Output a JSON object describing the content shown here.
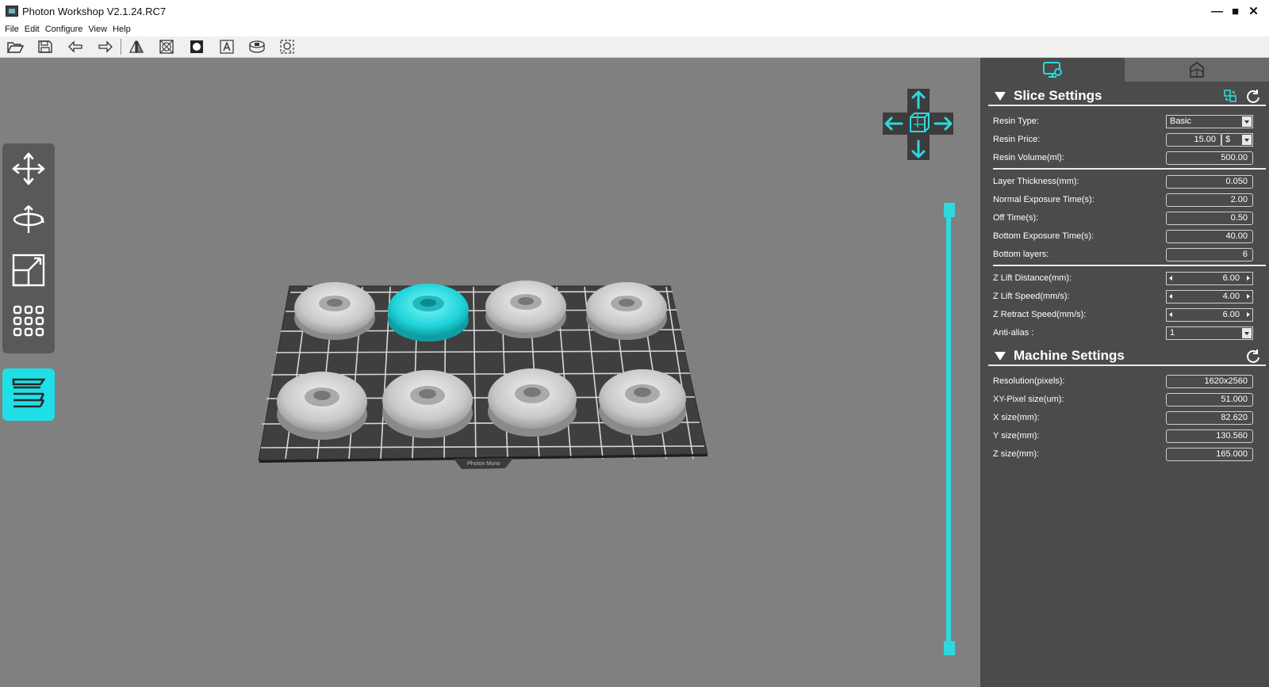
{
  "titlebar": {
    "title": "Photon Workshop V2.1.24.RC7"
  },
  "menu": [
    "File",
    "Edit",
    "Configure",
    "View",
    "Help"
  ],
  "toolbar": {
    "icons": [
      "open-icon",
      "save-icon",
      "undo-icon",
      "redo-icon",
      "mirror-icon",
      "hollow-icon",
      "mask-icon",
      "text-icon",
      "base-icon",
      "support-icon"
    ]
  },
  "left_tools": [
    "move-icon",
    "rotate-icon",
    "scale-icon",
    "arrange-icon"
  ],
  "slice_button": {
    "icon": "slice-layers-icon"
  },
  "build_plate": {
    "label": "Photon Mono"
  },
  "accent_color": "#1ee0e6",
  "slice_settings": {
    "title": "Slice Settings",
    "resin_type": {
      "label": "Resin Type:",
      "value": "Basic"
    },
    "resin_price": {
      "label": "Resin Price:",
      "value": "15.00",
      "currency": "$"
    },
    "resin_volume": {
      "label": "Resin Volume(ml):",
      "value": "500.00"
    },
    "layer_thickness": {
      "label": "Layer Thickness(mm):",
      "value": "0.050"
    },
    "normal_exposure": {
      "label": "Normal Exposure Time(s):",
      "value": "2.00"
    },
    "off_time": {
      "label": "Off Time(s):",
      "value": "0.50"
    },
    "bottom_exposure": {
      "label": "Bottom Exposure Time(s):",
      "value": "40.00"
    },
    "bottom_layers": {
      "label": "Bottom layers:",
      "value": "6"
    },
    "z_lift_distance": {
      "label": "Z Lift Distance(mm):",
      "value": "6.00"
    },
    "z_lift_speed": {
      "label": "Z Lift Speed(mm/s):",
      "value": "4.00"
    },
    "z_retract_speed": {
      "label": "Z Retract Speed(mm/s):",
      "value": "6.00"
    },
    "anti_alias": {
      "label": "Anti-alias :",
      "value": "1"
    }
  },
  "machine_settings": {
    "title": "Machine Settings",
    "resolution": {
      "label": "Resolution(pixels):",
      "value": "1620x2560"
    },
    "xy_pixel": {
      "label": "XY-Pixel size(um):",
      "value": "51.000"
    },
    "x_size": {
      "label": "X size(mm):",
      "value": "82.620"
    },
    "y_size": {
      "label": "Y size(mm):",
      "value": "130.560"
    },
    "z_size": {
      "label": "Z size(mm):",
      "value": "165.000"
    }
  }
}
